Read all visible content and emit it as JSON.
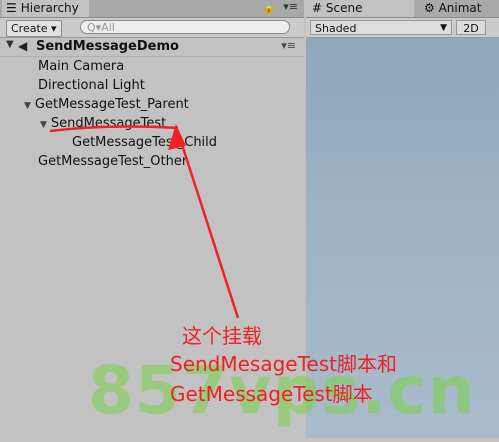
{
  "hierarchy": {
    "tab_icon": "list-icon",
    "tab_label": "Hierarchy",
    "lock_glyph": "🔒",
    "menu_glyph": "▾≡",
    "create_label": "Create ▾",
    "search_placeholder": "Q▾All",
    "scene_name": "SendMessageDemo",
    "scene_menu_glyph": "▾≡",
    "items": [
      {
        "label": "Main Camera"
      },
      {
        "label": "Directional Light"
      },
      {
        "label": "GetMessageTest_Parent"
      },
      {
        "label": "SendMessageTest"
      },
      {
        "label": "GetMessageTest_Child"
      },
      {
        "label": "GetMessageTest_Other"
      }
    ]
  },
  "scene": {
    "tab_label": "# Scene",
    "tab2_label": "Animat",
    "shading_value": "Shaded",
    "mode_2d_label": "2D"
  },
  "annotation": {
    "line1": "这个挂载",
    "line2": "SendMesageTest脚本和",
    "line3": "GetMessageTest脚本",
    "color": "#ee2222"
  },
  "watermark": "857vps.cn"
}
